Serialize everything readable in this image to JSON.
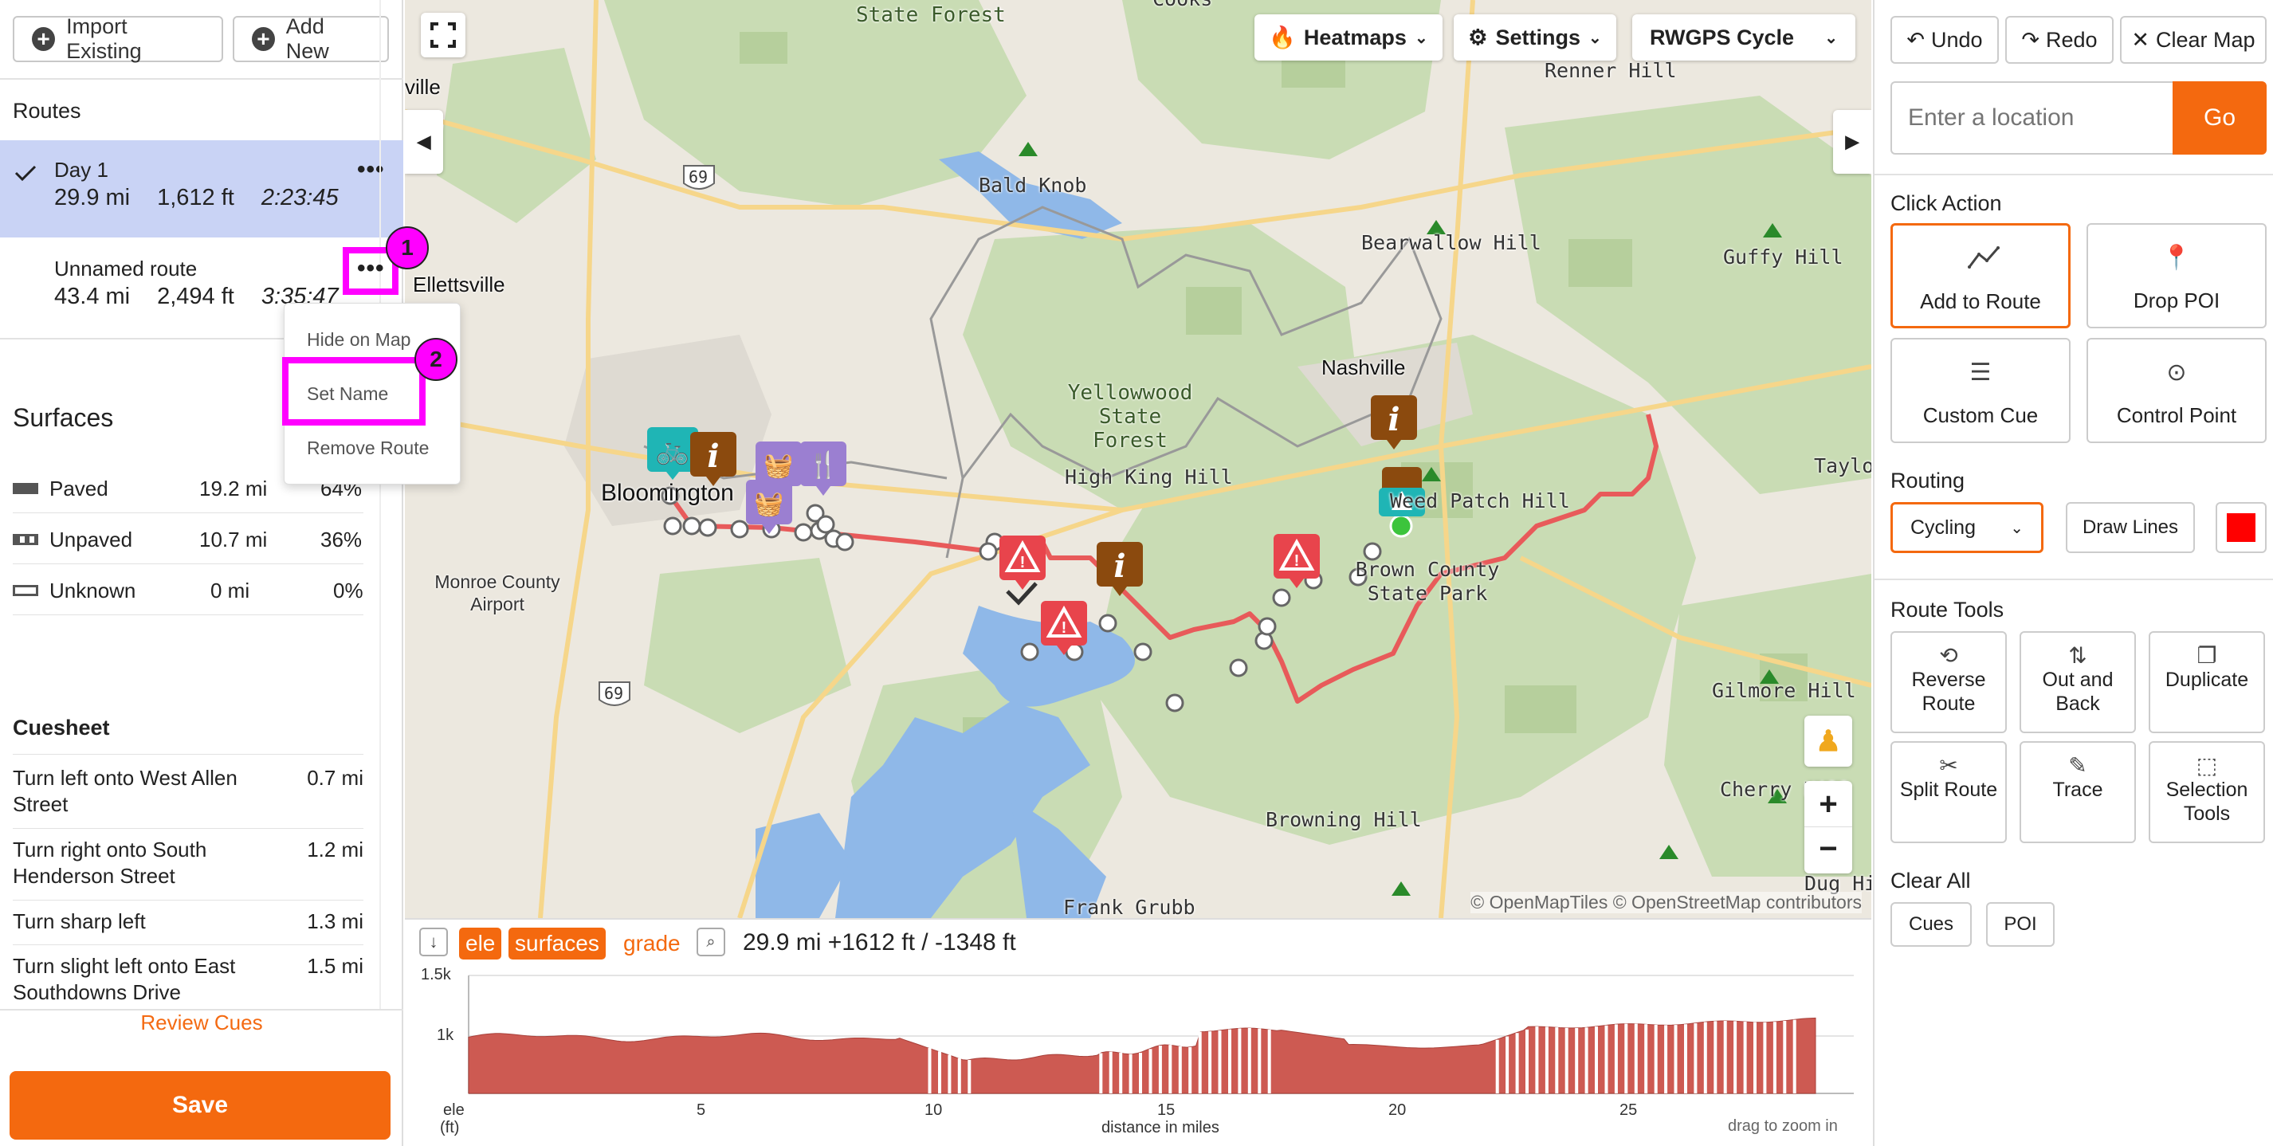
{
  "left": {
    "import_label": "Import Existing",
    "add_label": "Add New",
    "routes_title": "Routes",
    "routes": [
      {
        "name": "Day 1",
        "distance": "29.9 mi",
        "elevation": "1,612 ft",
        "time": "2:23:45"
      },
      {
        "name": "Unnamed route",
        "distance": "43.4 mi",
        "elevation": "2,494 ft",
        "time": "3:35:47"
      }
    ],
    "menu": {
      "hide": "Hide on Map",
      "set_name": "Set Name",
      "remove": "Remove Route"
    },
    "annotations": [
      "1",
      "2"
    ],
    "surfaces_title": "Surfaces",
    "surfaces": [
      {
        "label": "Paved",
        "dist": "19.2 mi",
        "pct": "64%"
      },
      {
        "label": "Unpaved",
        "dist": "10.7 mi",
        "pct": "36%"
      },
      {
        "label": "Unknown",
        "dist": "0 mi",
        "pct": "0%"
      }
    ],
    "cuesheet_title": "Cuesheet",
    "cues": [
      {
        "text": "Turn left onto West Allen Street",
        "dist": "0.7 mi"
      },
      {
        "text": "Turn right onto South Henderson Street",
        "dist": "1.2 mi"
      },
      {
        "text": "Turn sharp left",
        "dist": "1.3 mi"
      },
      {
        "text": "Turn slight left onto East Southdowns Drive",
        "dist": "1.5 mi"
      }
    ],
    "review_label": "Review Cues",
    "save_label": "Save"
  },
  "map": {
    "heatmaps_label": "Heatmaps",
    "settings_label": "Settings",
    "style_label": "RWGPS Cycle",
    "attribution": "© OpenMapTiles © OpenStreetMap contributors",
    "places": {
      "state_forest_top": "State Forest",
      "cooks": "Cooks",
      "renner": "Renner Hill",
      "ville": "ville",
      "bald_knob": "Bald Knob",
      "bearwallow": "Bearwallow Hill",
      "guffy": "Guffy Hill",
      "ellettsville": "Ellettsville",
      "nashville": "Nashville",
      "yellowwood": "Yellowwood State Forest",
      "high_king": "High King Hill",
      "bloomington": "Bloomington",
      "watch_hatch": "Weed Patch Hill",
      "taylor": "Taylor",
      "monroe_airport": "Monroe County Airport",
      "brown_county": "Brown County State Park",
      "gilmore": "Gilmore Hill",
      "cherry": "Cherry Hill",
      "browning": "Browning Hill",
      "dug": "Dug Hill",
      "frank_grubb": "Frank Grubb",
      "hwy69a": "69",
      "hwy69b": "69"
    }
  },
  "elevation": {
    "ele_label": "ele",
    "surfaces_label": "surfaces",
    "grade_label": "grade",
    "summary": "29.9 mi +1612 ft / -1348 ft",
    "y_ticks": [
      "1.5k",
      "1k"
    ],
    "y_unit_a": "ele",
    "y_unit_b": "(ft)",
    "x_ticks": [
      "5",
      "10",
      "15",
      "20",
      "25"
    ],
    "x_label": "distance in miles",
    "hint": "drag to zoom in"
  },
  "right": {
    "undo_label": "Undo",
    "redo_label": "Redo",
    "clear_label": "Clear Map",
    "location_placeholder": "Enter a location",
    "go_label": "Go",
    "click_action_title": "Click Action",
    "click_actions": [
      "Add to Route",
      "Drop POI",
      "Custom Cue",
      "Control Point"
    ],
    "routing_title": "Routing",
    "routing_mode": "Cycling",
    "draw_lines_label": "Draw Lines",
    "route_color": "#ff0000",
    "route_tools_title": "Route Tools",
    "route_tools": [
      "Reverse Route",
      "Out and Back",
      "Duplicate",
      "Split Route",
      "Trace",
      "Selection Tools"
    ],
    "clear_all_title": "Clear All",
    "clear_cues": "Cues",
    "clear_poi": "POI"
  },
  "colors": {
    "accent": "#f4690f",
    "highlight": "#ff00ff",
    "selected_route": "#c9d3f5",
    "route_line": "#e85a5a"
  }
}
